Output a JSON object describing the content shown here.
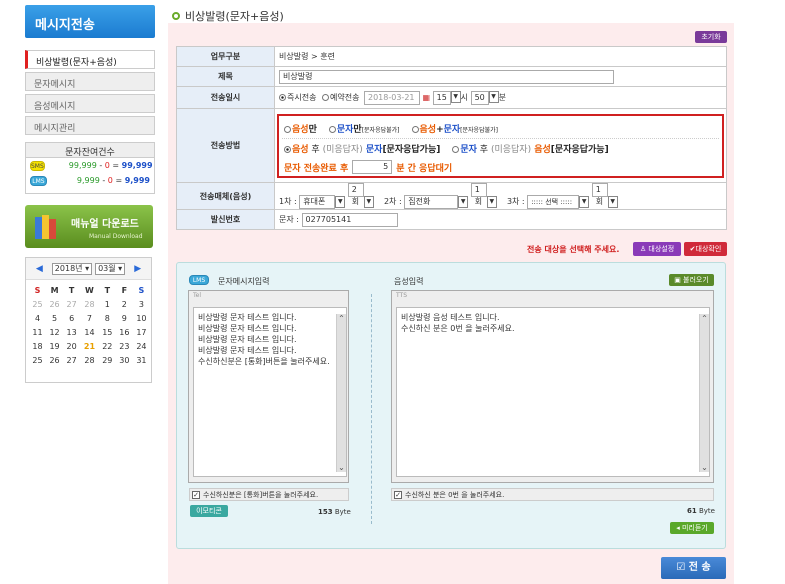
{
  "sidebar": {
    "title": "메시지전송",
    "items": [
      {
        "label": "비상발령(문자+음성)"
      },
      {
        "label": "문자메시지"
      },
      {
        "label": "음성메시지"
      },
      {
        "label": "메시지관리"
      }
    ],
    "balance": {
      "title": "문자잔여건수",
      "sms": {
        "tag": "SMS",
        "total": "99,999",
        "used": "0",
        "remain": "99,999"
      },
      "lms": {
        "tag": "LMS",
        "total": "9,999",
        "used": "0",
        "remain": "9,999"
      },
      "minus": "-",
      "eq": "="
    },
    "manual": {
      "label": "매뉴얼 다운로드",
      "sub": "Manual Download"
    },
    "calendar": {
      "year": "2018년",
      "month": "03월",
      "days": [
        "S",
        "M",
        "T",
        "W",
        "T",
        "F",
        "S"
      ],
      "rows": [
        [
          "25",
          "26",
          "27",
          "28",
          "1",
          "2",
          "3"
        ],
        [
          "4",
          "5",
          "6",
          "7",
          "8",
          "9",
          "10"
        ],
        [
          "11",
          "12",
          "13",
          "14",
          "15",
          "16",
          "17"
        ],
        [
          "18",
          "19",
          "20",
          "21",
          "22",
          "23",
          "24"
        ],
        [
          "25",
          "26",
          "27",
          "28",
          "29",
          "30",
          "31"
        ]
      ]
    }
  },
  "page": {
    "title": "비상발령(문자+음성)",
    "init_btn": "초기화"
  },
  "form": {
    "type_label": "업무구분",
    "type_value": "비상발령 > 훈련",
    "subject_label": "제목",
    "subject_value": "비상발령",
    "time_label": "전송일시",
    "instant": "즉시전송",
    "reserve": "예약전송",
    "date": "2018-03-21",
    "hour": "15",
    "hour_unit": "시",
    "min": "50",
    "min_unit": "분",
    "method_label": "전송방법",
    "m1a": "음성",
    "m1b": "만",
    "m2a": "문자",
    "m2b": "만",
    "m2c": "[문자응답불가]",
    "m3a": "음성",
    "m3p": "+",
    "m3b": "문자",
    "m3c": "[문자응답불가]",
    "m4a": "음성",
    "m4b": " 후 ",
    "m4c": "(미응답자)",
    "m4d": " 문자",
    "m4e": "[문자응답가능]",
    "m5a": "문자",
    "m5b": " 후 ",
    "m5c": "(미응답자)",
    "m5d": " 음성",
    "m5e": "[문자응답가능]",
    "m6a": "문자 전송완료 후",
    "m6v": "5",
    "m6b": "분 간 응답대기",
    "media_label": "전송매체(음성)",
    "c1": "1차 :",
    "c1a": "휴대폰",
    "c1b": "2회",
    "c2": "2차 :",
    "c2a": "집전화",
    "c2b": "1회",
    "c3": "3차 :",
    "c3a": "::::: 선택 :::::",
    "c3b": "1회",
    "sender_label": "발신번호",
    "sender_prefix": "문자 :",
    "sender_value": "027705141"
  },
  "target": {
    "msg": "전송 대상을 선택해 주세요.",
    "set_btn": "대상설정",
    "check_btn": "대상확인"
  },
  "msg": {
    "lms_tag": "LMS",
    "sms_title": "문자메시지입력",
    "tel": "Tel",
    "sms_text": "비상발령 문자 테스트 입니다.\n비상발령 문자 테스트 입니다.\n비상발령 문자 테스트 입니다.\n비상발령 문자 테스트 입니다.\n수신하신분은 [통화]버튼을 눌러주세요.",
    "sms_check": "수신하신분은 [통화]버튼을 눌러주세요.",
    "emoticon": "이모티콘",
    "sms_bytes": "153",
    "byte_unit": "Byte",
    "voice_title": "음성입력",
    "load_btn": "불러오기",
    "tts": "TTS",
    "voice_text": "비상발령 음성 테스트 입니다.\n수신하신 분은 0번 을 눌러주세요.",
    "voice_check": "수신하신 분은 0번 을 눌러주세요.",
    "voice_bytes": "61",
    "preview_btn": "미리듣기"
  },
  "send": "전 송"
}
